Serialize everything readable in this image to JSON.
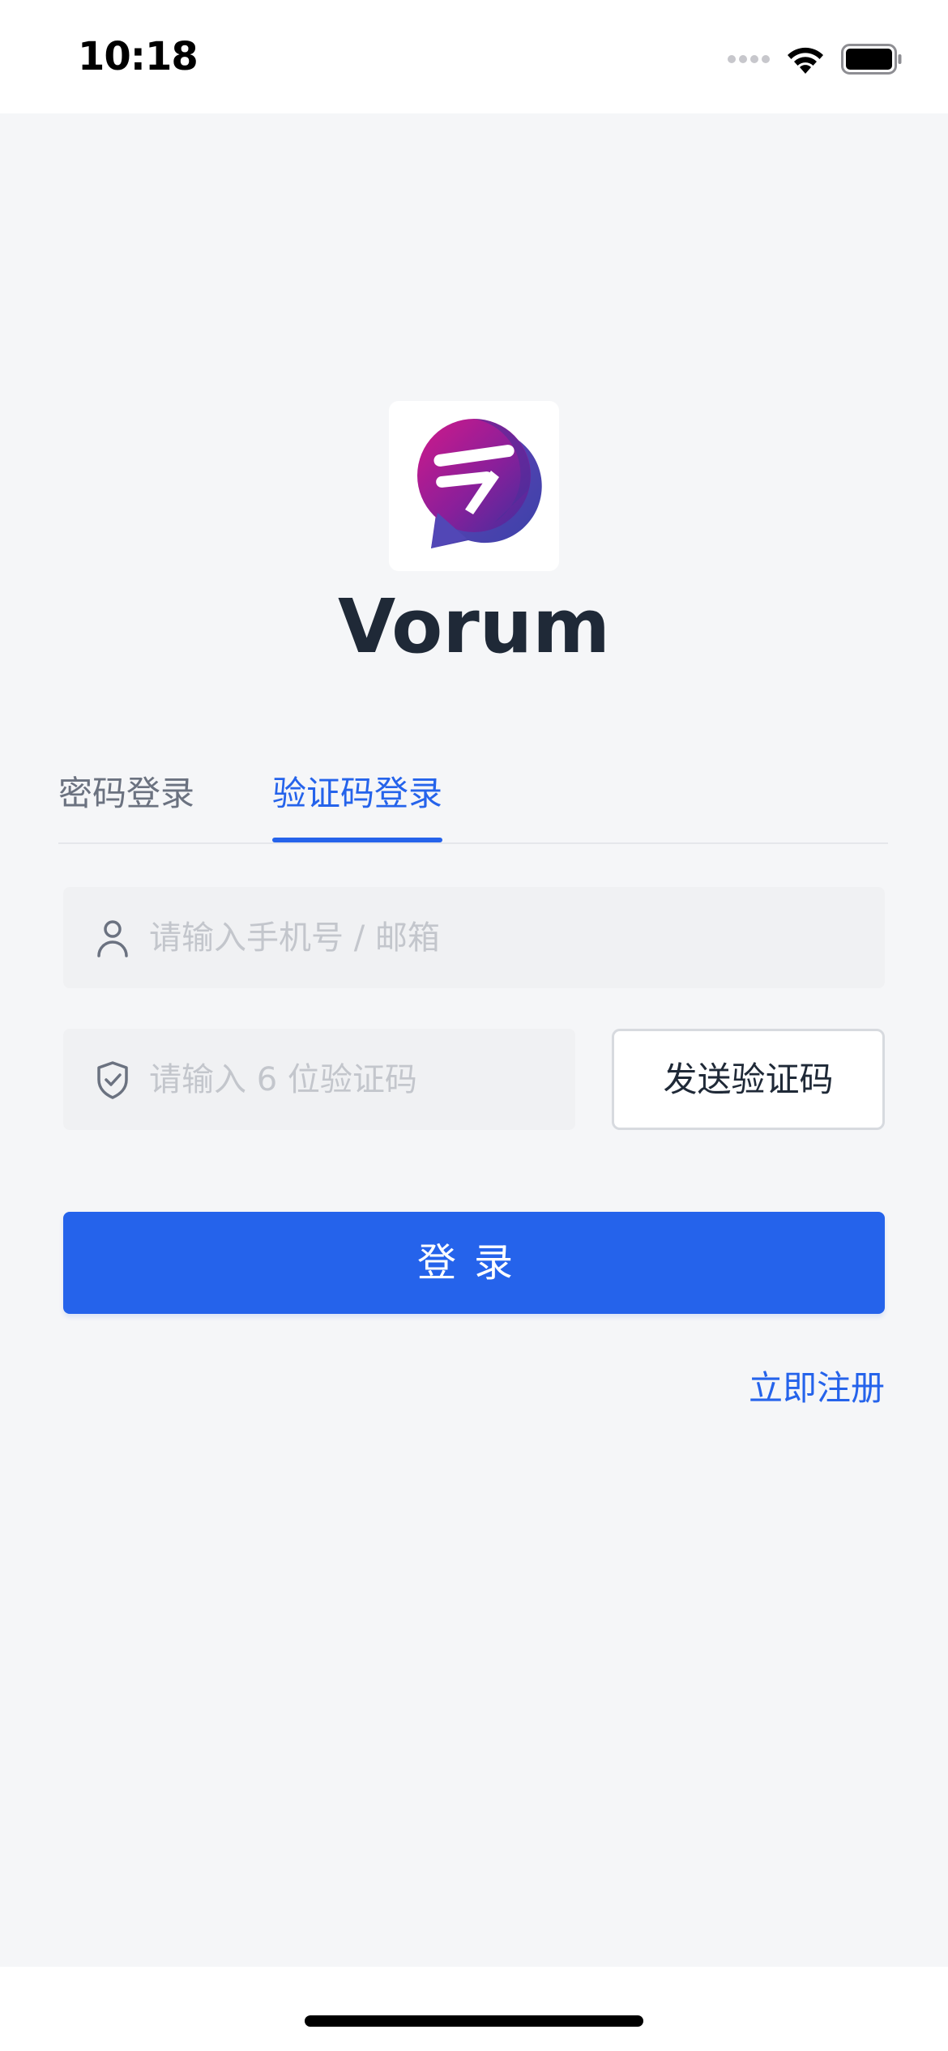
{
  "status_bar": {
    "time": "10:18"
  },
  "app": {
    "name": "Vorum",
    "brand_colors": [
      "#c21d8c",
      "#5b3fb0",
      "#2563eb"
    ]
  },
  "tabs": [
    {
      "label": "密码登录",
      "active": false
    },
    {
      "label": "验证码登录",
      "active": true
    }
  ],
  "form": {
    "account": {
      "placeholder": "请输入手机号 / 邮箱",
      "value": "",
      "icon": "user-icon"
    },
    "code": {
      "placeholder": "请输入 6 位验证码",
      "value": "",
      "icon": "shield-check-icon"
    },
    "send_code_label": "发送验证码",
    "login_label": "登录",
    "register_label": "立即注册"
  },
  "colors": {
    "accent": "#2563eb",
    "background": "#f5f6f8",
    "input_bg": "#f0f1f3"
  }
}
